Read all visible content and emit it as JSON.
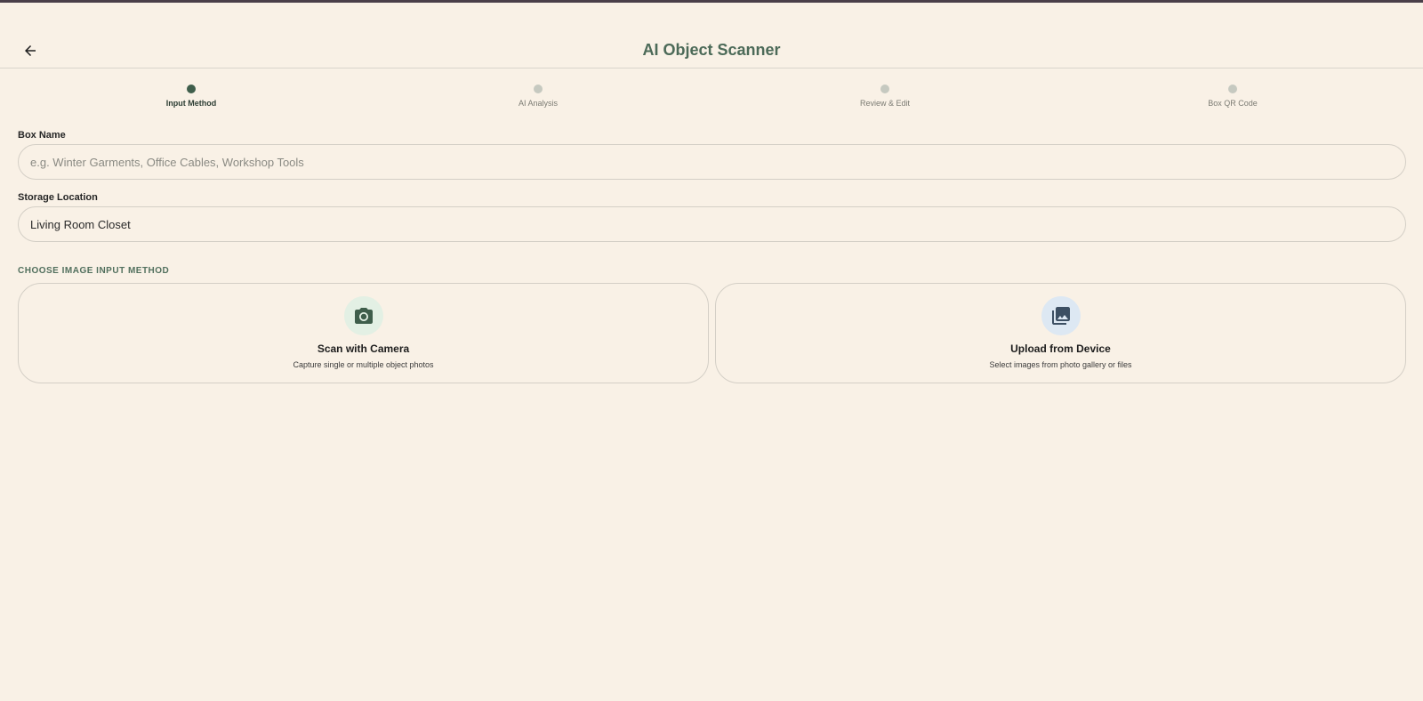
{
  "header": {
    "title": "AI Object Scanner",
    "back_icon": "arrow-left-icon"
  },
  "stepper": {
    "steps": [
      {
        "label": "Input Method",
        "state": "active"
      },
      {
        "label": "AI Analysis",
        "state": "inactive"
      },
      {
        "label": "Review & Edit",
        "state": "inactive"
      },
      {
        "label": "Box QR Code",
        "state": "inactive"
      }
    ]
  },
  "form": {
    "box_name": {
      "label": "Box Name",
      "value": "",
      "placeholder": "e.g. Winter Garments, Office Cables, Workshop Tools"
    },
    "storage_location": {
      "label": "Storage Location",
      "value": "Living Room Closet",
      "placeholder": ""
    }
  },
  "input_method": {
    "section_title": "CHOOSE IMAGE INPUT METHOD",
    "options": [
      {
        "title": "Scan with Camera",
        "subtitle": "Capture single or multiple object photos",
        "icon": "camera-icon",
        "icon_bg": "#e3f0e4",
        "icon_color": "#3f5e4b"
      },
      {
        "title": "Upload from Device",
        "subtitle": "Select images from photo gallery or files",
        "icon": "photo-library-icon",
        "icon_bg": "#dde8f3",
        "icon_color": "#3c4f63"
      }
    ]
  },
  "colors": {
    "background": "#f9f1e6",
    "accent": "#4c6a58",
    "active_step": "#3f5e4b",
    "inactive_step": "#c6c9c0"
  }
}
